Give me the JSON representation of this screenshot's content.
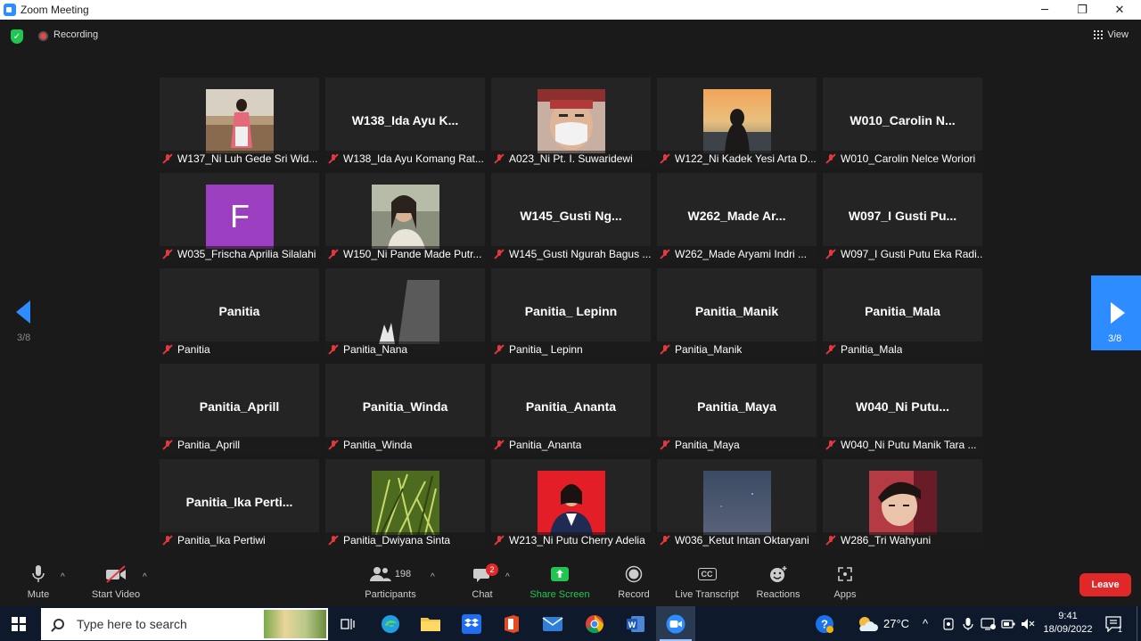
{
  "window": {
    "title": "Zoom Meeting",
    "minimize": "─",
    "restore": "❐",
    "close": "✕"
  },
  "topbar": {
    "security_glyph": "✓",
    "recording_label": "Recording",
    "view_label": "View"
  },
  "gallery": {
    "tiles": [
      {
        "photo": "beach-girl",
        "label": "W137_Ni Luh Gede Sri Wid..."
      },
      {
        "display": "W138_Ida Ayu K...",
        "label": "W138_Ida Ayu Komang Rat..."
      },
      {
        "photo": "masked-face",
        "label": "A023_Ni Pt. I. Suwaridewi"
      },
      {
        "photo": "sunset-silhouette",
        "label": "W122_Ni Kadek Yesi Arta D..."
      },
      {
        "display": "W010_Carolin  N...",
        "label": "W010_Carolin Nelce Woriori"
      },
      {
        "avatar_letter": "F",
        "label": "W035_Frischa Aprilia Silalahi"
      },
      {
        "photo": "portrait-girl",
        "label": "W150_Ni Pande Made Putr..."
      },
      {
        "display": "W145_Gusti  Ng...",
        "label": "W145_Gusti Ngurah Bagus ..."
      },
      {
        "display": "W262_Made  Ar...",
        "label": "W262_Made Aryami Indri ..."
      },
      {
        "display": "W097_I  Gusti  Pu...",
        "label": "W097_I Gusti Putu Eka Radi..."
      },
      {
        "display": "Panitia",
        "label": "Panitia"
      },
      {
        "photo": "bw-hand",
        "label": "Panitia_Nana"
      },
      {
        "display": "Panitia_  Lepinn",
        "label": "Panitia_ Lepinn"
      },
      {
        "display": "Panitia_Manik",
        "label": "Panitia_Manik"
      },
      {
        "display": "Panitia_Mala",
        "label": "Panitia_Mala"
      },
      {
        "display": "Panitia_Aprill",
        "label": "Panitia_Aprill"
      },
      {
        "display": "Panitia_Winda",
        "label": "Panitia_Winda"
      },
      {
        "display": "Panitia_Ananta",
        "label": "Panitia_Ananta"
      },
      {
        "display": "Panitia_Maya",
        "label": "Panitia_Maya"
      },
      {
        "display": "W040_Ni  Putu...",
        "label": "W040_Ni Putu Manik Tara ..."
      },
      {
        "display": "Panitia_Ika  Perti...",
        "label": "Panitia_Ika Pertiwi"
      },
      {
        "photo": "green-plant",
        "label": "Panitia_Dwiyana Sinta"
      },
      {
        "photo": "red-portrait",
        "label": "W213_Ni Putu Cherry Adelia"
      },
      {
        "photo": "night-sky",
        "label": "W036_Ketut Intan Oktaryani"
      },
      {
        "photo": "selfie",
        "label": "W286_Tri Wahyuni"
      }
    ]
  },
  "pager": {
    "left_page": "3/8",
    "right_page": "3/8"
  },
  "toolbar": {
    "mute_label": "Mute",
    "video_label": "Start Video",
    "participants_label": "Participants",
    "participants_count": "198",
    "chat_label": "Chat",
    "chat_badge": "2",
    "share_label": "Share Screen",
    "record_label": "Record",
    "transcript_label": "Live Transcript",
    "transcript_icon_text": "CC",
    "reactions_label": "Reactions",
    "apps_label": "Apps",
    "leave_label": "Leave",
    "caret": "^"
  },
  "taskbar": {
    "search_placeholder": "Type here to search",
    "temperature": "27°C",
    "time": "9:41",
    "date": "18/09/2022",
    "notification_count": "1",
    "chevron": "^"
  },
  "colors": {
    "accent": "#2d8cff",
    "share_green": "#23c552",
    "leave_red": "#e02828",
    "muted_red": "#e0393e"
  }
}
